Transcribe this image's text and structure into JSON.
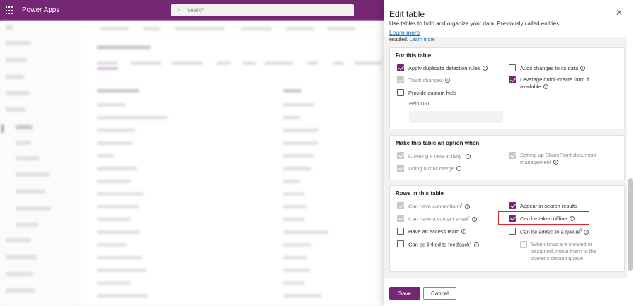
{
  "topbar": {
    "app_title": "Power Apps",
    "search_placeholder": "Search"
  },
  "panel": {
    "title": "Edit table",
    "description": "Use tables to hold and organize your data. Previously called entities",
    "learn_more": "Learn more",
    "enabled_text": "enabled.",
    "enabled_learn_more": "Learn more",
    "for_this_table": {
      "title": "For this table",
      "items": [
        {
          "label": "Apply duplicate detection rules",
          "state": "checked"
        },
        {
          "label": "Audit changes to its data",
          "state": "unchecked"
        },
        {
          "label": "Track changes",
          "state": "disabled-checked"
        },
        {
          "label": "Leverage quick-create form if available",
          "state": "checked"
        },
        {
          "label": "Provide custom help",
          "state": "unchecked"
        }
      ],
      "help_url_label": "Help URL"
    },
    "option_when": {
      "title": "Make this table an option when",
      "items": [
        {
          "label": "Creating a new activity",
          "sup": "1",
          "state": "disabled-checked"
        },
        {
          "label": "Setting up SharePoint document management",
          "state": "disabled-checked"
        },
        {
          "label": "Doing a mail merge",
          "state": "disabled-checked"
        }
      ]
    },
    "rows": {
      "title": "Rows in this table",
      "items": [
        {
          "label": "Can have connections",
          "sup": "1",
          "state": "disabled-checked"
        },
        {
          "label": "Appear in search results",
          "state": "checked"
        },
        {
          "label": "Can have a contact email",
          "sup": "1",
          "state": "disabled-checked"
        },
        {
          "label": "Can be taken offline",
          "state": "checked"
        },
        {
          "label": "Have an access team",
          "state": "unchecked"
        },
        {
          "label": "Can be added to a queue",
          "sup": "1",
          "state": "unchecked"
        },
        {
          "label": "Can be linked to feedback",
          "sup": "1",
          "state": "unchecked"
        },
        {
          "label": "When rows are created or assigned, move them to the owner's default queue",
          "state": "disabled-unchecked"
        }
      ]
    },
    "footer": {
      "save_label": "Save",
      "cancel_label": "Cancel"
    }
  },
  "colors": {
    "brand": "#742774",
    "link": "#0f6cbd",
    "highlight": "#e3262b"
  },
  "icons": {
    "waffle": "app-launcher-icon",
    "search": "search-icon",
    "close": "close-icon",
    "info": "info-icon"
  }
}
